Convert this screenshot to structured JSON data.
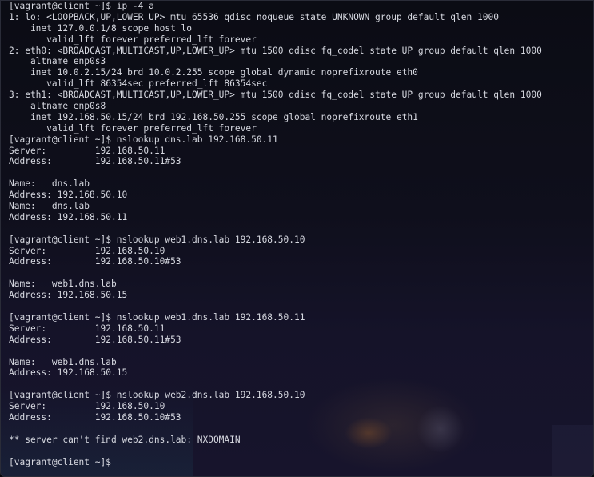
{
  "terminal": {
    "lines": [
      "[vagrant@client ~]$ ip -4 a",
      "1: lo: <LOOPBACK,UP,LOWER_UP> mtu 65536 qdisc noqueue state UNKNOWN group default qlen 1000",
      "    inet 127.0.0.1/8 scope host lo",
      "       valid_lft forever preferred_lft forever",
      "2: eth0: <BROADCAST,MULTICAST,UP,LOWER_UP> mtu 1500 qdisc fq_codel state UP group default qlen 1000",
      "    altname enp0s3",
      "    inet 10.0.2.15/24 brd 10.0.2.255 scope global dynamic noprefixroute eth0",
      "       valid_lft 86354sec preferred_lft 86354sec",
      "3: eth1: <BROADCAST,MULTICAST,UP,LOWER_UP> mtu 1500 qdisc fq_codel state UP group default qlen 1000",
      "    altname enp0s8",
      "    inet 192.168.50.15/24 brd 192.168.50.255 scope global noprefixroute eth1",
      "       valid_lft forever preferred_lft forever",
      "[vagrant@client ~]$ nslookup dns.lab 192.168.50.11",
      "Server:         192.168.50.11",
      "Address:        192.168.50.11#53",
      "",
      "Name:   dns.lab",
      "Address: 192.168.50.10",
      "Name:   dns.lab",
      "Address: 192.168.50.11",
      "",
      "[vagrant@client ~]$ nslookup web1.dns.lab 192.168.50.10",
      "Server:         192.168.50.10",
      "Address:        192.168.50.10#53",
      "",
      "Name:   web1.dns.lab",
      "Address: 192.168.50.15",
      "",
      "[vagrant@client ~]$ nslookup web1.dns.lab 192.168.50.11",
      "Server:         192.168.50.11",
      "Address:        192.168.50.11#53",
      "",
      "Name:   web1.dns.lab",
      "Address: 192.168.50.15",
      "",
      "[vagrant@client ~]$ nslookup web2.dns.lab 192.168.50.10",
      "Server:         192.168.50.10",
      "Address:        192.168.50.10#53",
      "",
      "** server can't find web2.dns.lab: NXDOMAIN",
      "",
      "[vagrant@client ~]$ "
    ],
    "colors": {
      "foreground": "#d6d8e0",
      "background": "#0b0c14"
    }
  }
}
